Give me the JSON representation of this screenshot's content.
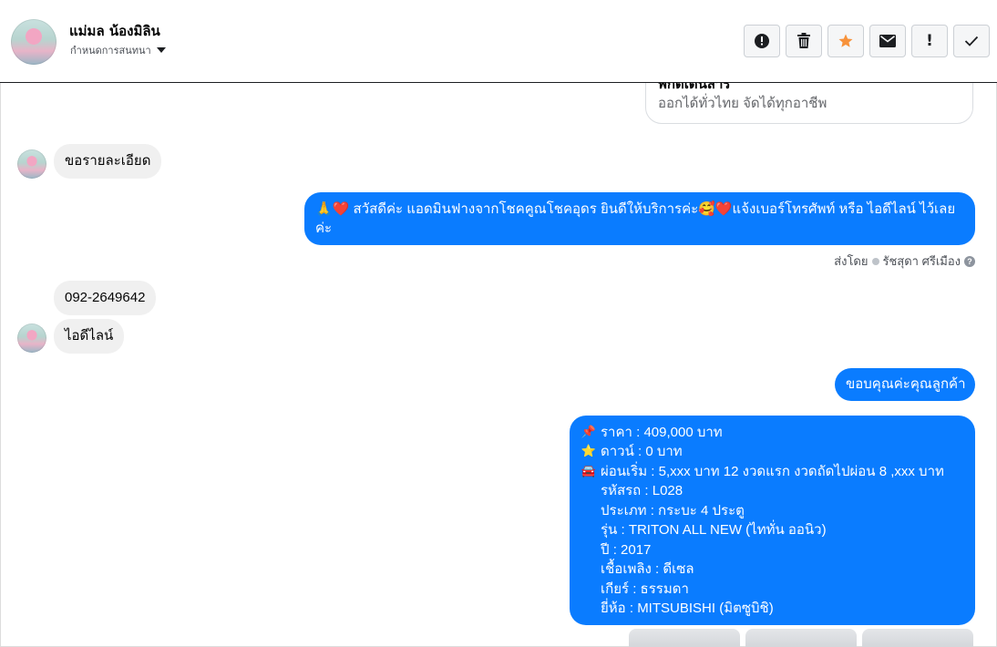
{
  "header": {
    "contact_name": "แม่มล น้องมิลิน",
    "conversation_menu": "กำหนดการสนทนา",
    "toolbar": {
      "icons": [
        "alert-circle-icon",
        "trash-icon",
        "star-icon",
        "envelope-icon",
        "exclamation-icon",
        "checkmark-icon"
      ],
      "star_color": "#f7923b"
    }
  },
  "thread": {
    "partial_card": {
      "title": "พิกัดเดินสาร",
      "subtitle": "ออกได้ทั่วไทย จัดได้ทุกอาชีพ"
    },
    "msg1": "ขอรายละเอียด",
    "msg2_part1": "สวัสดีค่ะ แอดมินฟางจากโชคคูณโชคอุดร ยินดีให้บริการค่ะ",
    "msg2_part2": "แจ้งเบอร์โทรศัพท์ หรือ ไอดีไลน์  ไว้เลย",
    "msg2_part3": "ค่ะ",
    "sent_by_label": "ส่งโดย",
    "sent_by_name": "รัชสุดา ศรีเมือง",
    "msg3": "092-2649642",
    "msg4": "ไอดีไลน์",
    "msg5": "ขอบคุณค่ะคุณลูกค้า",
    "details": [
      {
        "emoji": "📌",
        "text": "ราคา : 409,000 บาท"
      },
      {
        "emoji": "⭐",
        "text": "ดาวน์ : 0 บาท"
      },
      {
        "emoji": "🚘",
        "text": "ผ่อนเริ่ม : 5,xxx บาท 12 งวดแรก   งวดถัดไปผ่อน  8 ,xxx  บาท"
      },
      {
        "emoji": "",
        "text": "รหัสรถ : L028"
      },
      {
        "emoji": "",
        "text": "ประเภท : กระบะ 4 ประตู"
      },
      {
        "emoji": "",
        "text": "รุ่น : TRITON ALL NEW (ไททั่น ออนิว)"
      },
      {
        "emoji": "",
        "text": "ปี : 2017"
      },
      {
        "emoji": "",
        "text": "เชื้อเพลิง : ดีเซล"
      },
      {
        "emoji": "",
        "text": "เกียร์ : ธรรมดา"
      },
      {
        "emoji": "",
        "text": "ยี่ห้อ : MITSUBISHI (มิตซูบิชิ)"
      }
    ]
  },
  "colors": {
    "outgoing_bubble": "#0a7cff",
    "incoming_bubble": "#f0f0f0"
  }
}
